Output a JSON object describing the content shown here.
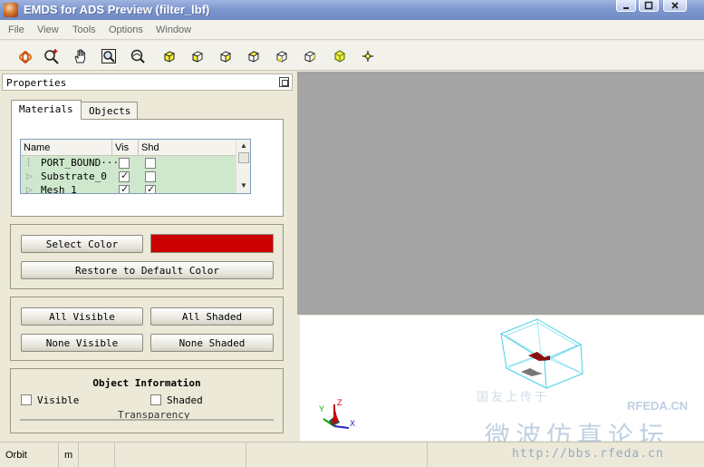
{
  "window": {
    "title": "EMDS for ADS Preview (filter_lbf)"
  },
  "menu": [
    "File",
    "View",
    "Tools",
    "Options",
    "Window"
  ],
  "toolbar": {
    "icons": [
      "rotate-icon",
      "zoom-icon",
      "pan-hand-icon",
      "zoom-fit-icon",
      "zoom-window-icon",
      "view-iso-1-icon",
      "view-iso-2-icon",
      "view-iso-3-icon",
      "view-iso-4-icon",
      "view-iso-5-icon",
      "view-iso-6-icon",
      "view-cube-highlight-icon",
      "center-point-icon"
    ]
  },
  "properties": {
    "title": "Properties",
    "tabs": [
      "Materials",
      "Objects"
    ],
    "active_tab": "Materials",
    "table": {
      "columns": [
        "Name",
        "Vis",
        "Shd"
      ],
      "rows": [
        {
          "name": "PORT_BOUND···",
          "vis": false,
          "shd": false
        },
        {
          "name": "Substrate_0",
          "vis": true,
          "shd": false
        },
        {
          "name": "Mesh 1",
          "vis": true,
          "shd": true
        }
      ]
    },
    "select_color_label": "Select Color",
    "selected_color": "#cc0000",
    "restore_label": "Restore to Default Color",
    "all_visible_label": "All Visible",
    "all_shaded_label": "All Shaded",
    "none_visible_label": "None Visible",
    "none_shaded_label": "None Shaded",
    "object_info_title": "Object Information",
    "visible_label": "Visible",
    "shaded_label": "Shaded",
    "transparency_label": "Transparency"
  },
  "status": {
    "mode": "Orbit",
    "units": "m"
  },
  "axes": {
    "z": "Z",
    "y": "Y",
    "x": "X"
  },
  "watermark": {
    "cn": "微波仿真论坛",
    "url": "http://bbs.rfeda.cn",
    "brand": "RFEDA.CN",
    "small": "国友上传于"
  }
}
